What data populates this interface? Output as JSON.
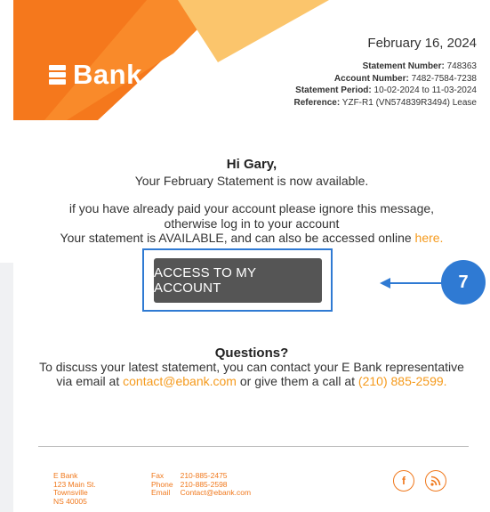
{
  "brand": {
    "name": "Bank"
  },
  "colors": {
    "orange": "#f5781c",
    "light_orange": "#fbc56c",
    "blue": "#2f7ad3",
    "button": "#555555"
  },
  "header": {
    "date": "February 16, 2024",
    "statement_number_label": "Statement Number:",
    "statement_number": "748363",
    "account_number_label": "Account Number:",
    "account_number": "7482-7584-7238",
    "statement_period_label": "Statement Period:",
    "statement_period": "10-02-2024 to 11-03-2024",
    "reference_label": "Reference:",
    "reference": "YZF-R1 (VN574839R3494) Lease"
  },
  "body": {
    "greeting": "Hi Gary,",
    "line1": "Your February Statement is now available.",
    "line2": "if you have already paid your account please ignore this message,",
    "line3": "otherwise log in to your account",
    "line4": "Your statement is AVAILABLE, and can also be accessed online",
    "here_link": "here.",
    "button_label": "ACCESS TO MY ACCOUNT"
  },
  "annotation": {
    "badge_number": "7"
  },
  "questions": {
    "title": "Questions?",
    "line1": "To discuss your latest statement, you can contact your E Bank representative",
    "line2_pre": "via email at",
    "email": "contact@ebank.com",
    "line2_mid": "or give them a call at",
    "phone": "(210) 885-2599."
  },
  "footer": {
    "address": [
      "E Bank",
      "123 Main St.",
      "Townsville",
      "NS 40005"
    ],
    "fax_label": "Fax",
    "fax": "210-885-2475",
    "phone_label": "Phone",
    "phone": "210-885-2598",
    "email_label": "Email",
    "email": "Contact@ebank.com",
    "social": [
      "facebook-icon",
      "rss-icon"
    ]
  }
}
